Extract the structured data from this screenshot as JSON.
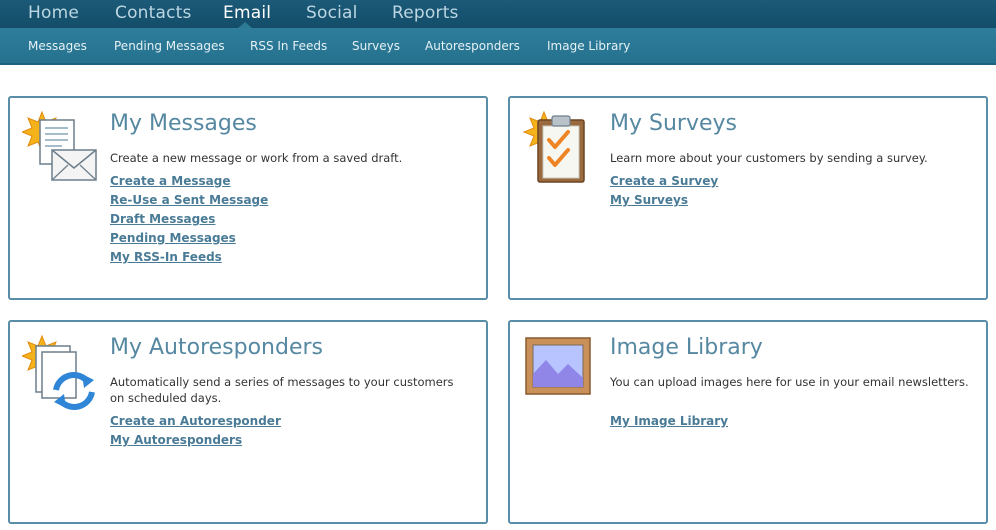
{
  "top_nav": {
    "items": [
      "Home",
      "Contacts",
      "Email",
      "Social",
      "Reports"
    ],
    "active": "Email"
  },
  "sub_nav": {
    "items": [
      "Messages",
      "Pending Messages",
      "RSS In Feeds",
      "Surveys",
      "Autoresponders",
      "Image Library"
    ]
  },
  "cards": {
    "messages": {
      "title": "My Messages",
      "description": "Create a new message or work from a saved draft.",
      "links": [
        "Create a Message",
        "Re-Use a Sent Message",
        "Draft Messages",
        "Pending Messages",
        "My RSS-In Feeds"
      ],
      "icon": "envelope-document-icon"
    },
    "surveys": {
      "title": "My Surveys",
      "description": "Learn more about your customers by sending a survey.",
      "links": [
        "Create a Survey",
        "My Surveys"
      ],
      "icon": "clipboard-checklist-icon"
    },
    "autoresponders": {
      "title": "My Autoresponders",
      "description": "Automatically send a series of messages to your customers on scheduled days.",
      "links": [
        "Create an Autoresponder",
        "My Autoresponders"
      ],
      "icon": "document-refresh-icon"
    },
    "images": {
      "title": "Image Library",
      "description": "You can upload images here for use in your email newsletters.",
      "links": [
        "My Image Library"
      ],
      "icon": "framed-picture-icon"
    }
  },
  "colors": {
    "top_nav_bg": "#1b5a78",
    "sub_nav_bg": "#2e7d9a",
    "card_border": "#5a8ea8",
    "title": "#5688a2",
    "link": "#4a7b96"
  }
}
